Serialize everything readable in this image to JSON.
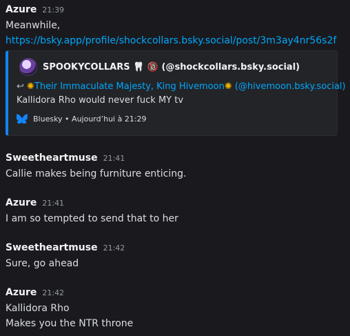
{
  "messages": [
    {
      "author": "Azure",
      "time": "21:39",
      "lines": [
        "Meanwhile,"
      ],
      "link": "https://bsky.app/profile/shockcollars.bsky.social/post/3m3ay4nr56s2f"
    },
    {
      "author": "Sweetheartmuse",
      "time": "21:41",
      "lines": [
        "Callie makes being furniture enticing."
      ]
    },
    {
      "author": "Azure",
      "time": "21:41",
      "lines": [
        "I am so tempted to send that to her"
      ]
    },
    {
      "author": "Sweetheartmuse",
      "time": "21:42",
      "lines": [
        "Sure, go ahead"
      ]
    },
    {
      "author": "Azure",
      "time": "21:42",
      "lines": [
        "Kallidora Rho",
        "Makes you the NTR throne"
      ]
    }
  ],
  "embed": {
    "author": "SPOOKYCOLLARS 🦷 🔞 (@shockcollars.bsky.social)",
    "reply_arrow": "↩",
    "reply_to": "Their Immaculate Majesty, King Hivemoon",
    "reply_handle": " (@hivemoon.bsky.social)",
    "sun": "✺",
    "text": "Kallidora Rho would never fuck MY tv",
    "footer": "Bluesky • Aujourd’hui à 21:29",
    "accent_color": "#1185fe"
  }
}
